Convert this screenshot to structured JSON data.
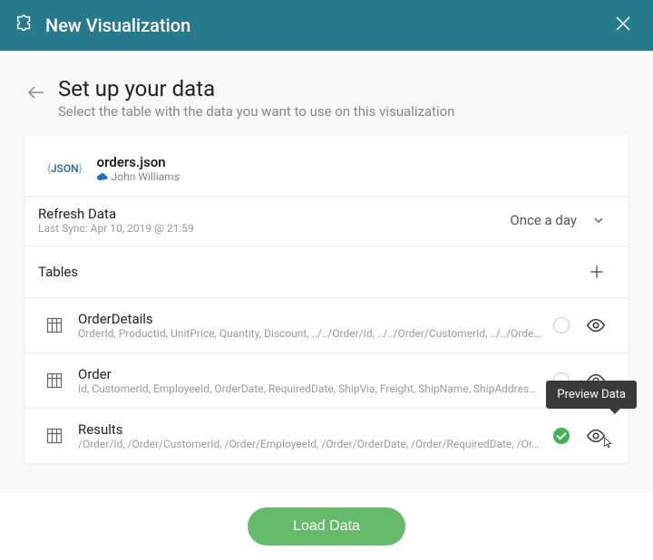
{
  "titlebar": {
    "title": "New Visualization"
  },
  "heading": {
    "title": "Set up your data",
    "subtitle": "Select the table with the data you want to use on this visualization"
  },
  "datasource": {
    "badge": "JSON",
    "filename": "orders.json",
    "owner": "John Williams"
  },
  "refresh": {
    "title": "Refresh Data",
    "last_sync": "Last Sync: Apr 10, 2019 @ 21:59",
    "frequency": "Once a day"
  },
  "tables_section": {
    "label": "Tables"
  },
  "tables": [
    {
      "name": "OrderDetails",
      "columns": "OrderId, ProductId, UnitPrice, Quantity, Discount, ../../Order/Id, ../../Order/CustomerId, ../../Orde…",
      "selected": false
    },
    {
      "name": "Order",
      "columns": "Id, CustomerId, EmployeeId, OrderDate, RequiredDate, ShipVia, Freight, ShipName, ShipAddres…",
      "selected": false
    },
    {
      "name": "Results",
      "columns": "/Order/Id, /Order/CustomerId, /Order/EmployeeId, /Order/OrderDate, /Order/RequiredDate, /Or…",
      "selected": true
    }
  ],
  "tooltip": {
    "preview": "Preview Data"
  },
  "footer": {
    "load_button": "Load Data"
  }
}
